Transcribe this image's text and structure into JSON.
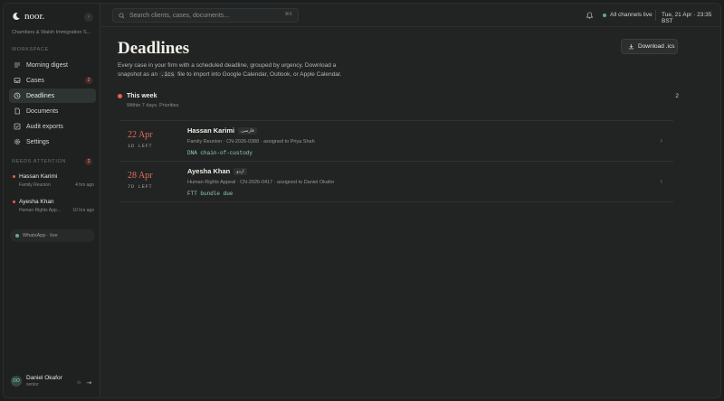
{
  "app": {
    "brand": "noor.",
    "firm": "Chambers & Walsh Immigration S..."
  },
  "sidebar": {
    "workspace_label": "WORKSPACE",
    "items": [
      {
        "label": "Morning digest",
        "icon": "list-icon"
      },
      {
        "label": "Cases",
        "icon": "inbox-icon",
        "badge": "2"
      },
      {
        "label": "Deadlines",
        "icon": "clock-icon",
        "active": true
      },
      {
        "label": "Documents",
        "icon": "document-icon"
      },
      {
        "label": "Audit exports",
        "icon": "checkbox-icon"
      },
      {
        "label": "Settings",
        "icon": "gear-icon"
      }
    ],
    "attention_label": "NEEDS ATTENTION",
    "attention_count": "2",
    "attention": [
      {
        "name": "Hassan Karimi",
        "sub": "Family Reunion",
        "time": "4 hrs ago"
      },
      {
        "name": "Ayesha Khan",
        "sub": "Human Rights App...",
        "time": "10 hrs ago"
      }
    ],
    "whatsapp": "WhatsApp · live",
    "user": {
      "initials": "DO",
      "name": "Daniel Okafor",
      "role": "senior"
    }
  },
  "topbar": {
    "search_placeholder": "Search clients, cases, documents...",
    "search_shortcut": "⌘K",
    "channels": "All channels live",
    "datetime": "Tue, 21 Apr · 23:35 BST"
  },
  "page": {
    "title": "Deadlines",
    "download_label": "Download .ics",
    "desc_1": "Every case in your firm with a scheduled deadline, grouped by urgency. Download a snapshot as an ",
    "desc_code": ".ics",
    "desc_2": " file to import into Google Calendar, Outlook, or Apple Calendar."
  },
  "group": {
    "title": "This week",
    "subtitle": "Within 7 days. Priorities",
    "count": "2"
  },
  "deadlines": [
    {
      "date": "22 Apr",
      "left": "1D LEFT",
      "name": "Hassan Karimi",
      "lang": "فارسی",
      "meta": "Family Reunion · CN-2026-0388 · assigned to Priya Shah",
      "action": "DNA chain-of-custody"
    },
    {
      "date": "28 Apr",
      "left": "7D LEFT",
      "name": "Ayesha Khan",
      "lang": "اردو",
      "meta": "Human Rights Appeal · CN-2026-0417 · assigned to Daniel Okafor",
      "action": "FTT bundle due"
    }
  ],
  "colors": {
    "urgent": "#e8604c",
    "live": "#5fae8a",
    "action_text": "#8fd1b2"
  }
}
